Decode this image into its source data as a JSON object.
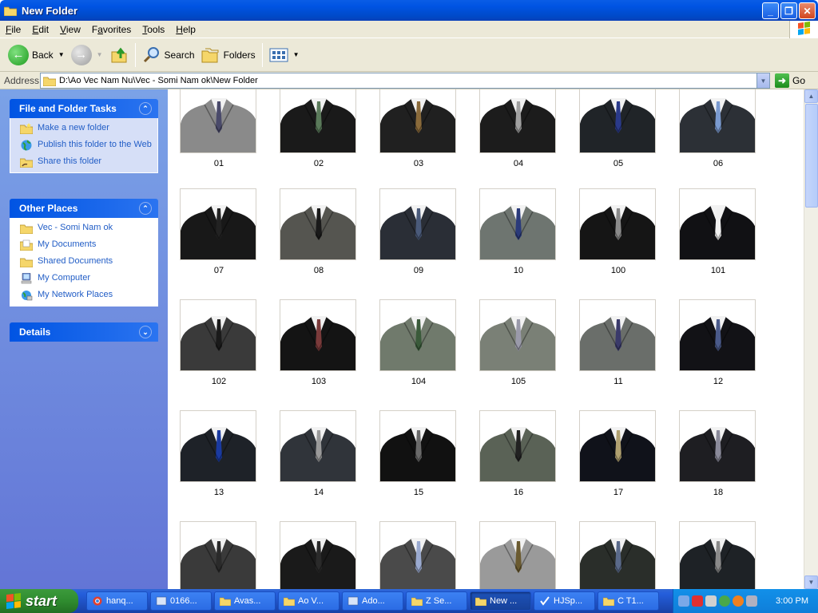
{
  "window": {
    "title": "New Folder"
  },
  "menu": [
    "File",
    "Edit",
    "View",
    "Favorites",
    "Tools",
    "Help"
  ],
  "menu_mnemonics": [
    "F",
    "E",
    "V",
    "a",
    "T",
    "H"
  ],
  "toolbar": {
    "back_label": "Back",
    "search_label": "Search",
    "folders_label": "Folders"
  },
  "address": {
    "label": "Address",
    "value": "D:\\Ao Vec Nam Nu\\Vec - Somi Nam ok\\New Folder",
    "go_label": "Go"
  },
  "sidebar": {
    "tasks": {
      "title": "File and Folder Tasks",
      "items": [
        {
          "label": "Make a new folder"
        },
        {
          "label": "Publish this folder to the Web"
        },
        {
          "label": "Share this folder"
        }
      ]
    },
    "places": {
      "title": "Other Places",
      "items": [
        {
          "label": "Vec - Somi Nam ok"
        },
        {
          "label": "My Documents"
        },
        {
          "label": "Shared Documents"
        },
        {
          "label": "My Computer"
        },
        {
          "label": "My Network Places"
        }
      ]
    },
    "details": {
      "title": "Details"
    }
  },
  "files": [
    {
      "name": "01",
      "suit": "#8a8a8a",
      "tie": "#4a4a6a"
    },
    {
      "name": "02",
      "suit": "#1a1a1a",
      "tie": "#5a7a5a"
    },
    {
      "name": "03",
      "suit": "#202020",
      "tie": "#8a6a3a"
    },
    {
      "name": "04",
      "suit": "#1c1c1c",
      "tie": "#a0a0a0"
    },
    {
      "name": "05",
      "suit": "#202428",
      "tie": "#2a3a8a"
    },
    {
      "name": "06",
      "suit": "#2c3036",
      "tie": "#7a9ad0"
    },
    {
      "name": "07",
      "suit": "#181818",
      "tie": "#222222"
    },
    {
      "name": "08",
      "suit": "#555550",
      "tie": "#1a1a1a"
    },
    {
      "name": "09",
      "suit": "#2a2e36",
      "tie": "#4a5a7a"
    },
    {
      "name": "10",
      "suit": "#6e7570",
      "tie": "#2a3a7a"
    },
    {
      "name": "100",
      "suit": "#151515",
      "tie": "#8a8a8a"
    },
    {
      "name": "101",
      "suit": "#111114",
      "tie": "#f0f0f0"
    },
    {
      "name": "102",
      "suit": "#3a3a3a",
      "tie": "#1a1a1a"
    },
    {
      "name": "103",
      "suit": "#141414",
      "tie": "#7a3a3a"
    },
    {
      "name": "104",
      "suit": "#707a6c",
      "tie": "#3a5a3a"
    },
    {
      "name": "105",
      "suit": "#7a8076",
      "tie": "#9a9aaa"
    },
    {
      "name": "11",
      "suit": "#6a6e6a",
      "tie": "#3a3a6a"
    },
    {
      "name": "12",
      "suit": "#121216",
      "tie": "#4a5a8a"
    },
    {
      "name": "13",
      "suit": "#1e2228",
      "tie": "#1a3aa0"
    },
    {
      "name": "14",
      "suit": "#30343a",
      "tie": "#9a9a9a"
    },
    {
      "name": "15",
      "suit": "#111111",
      "tie": "#6a6a6a"
    },
    {
      "name": "16",
      "suit": "#5a6256",
      "tie": "#222222"
    },
    {
      "name": "17",
      "suit": "#10121a",
      "tie": "#b0a070"
    },
    {
      "name": "18",
      "suit": "#1e1e22",
      "tie": "#8a8a9a"
    },
    {
      "name": "",
      "suit": "#3a3a3a",
      "tie": "#2a2a2a"
    },
    {
      "name": "",
      "suit": "#1a1a1a",
      "tie": "#2a2a2a"
    },
    {
      "name": "",
      "suit": "#4a4a4a",
      "tie": "#9aaad0"
    },
    {
      "name": "",
      "suit": "#9a9a9a",
      "tie": "#6a5a30"
    },
    {
      "name": "",
      "suit": "#2a2e2a",
      "tie": "#5a6a8a"
    },
    {
      "name": "",
      "suit": "#1e2226",
      "tie": "#8a8a8a"
    }
  ],
  "taskbar": {
    "start_label": "start",
    "items": [
      {
        "label": "hanq...",
        "icon": "chrome-icon"
      },
      {
        "label": "0166...",
        "icon": "app-icon"
      },
      {
        "label": "Avas...",
        "icon": "folder-icon"
      },
      {
        "label": "Ao V...",
        "icon": "folder-icon"
      },
      {
        "label": "Ado...",
        "icon": "app-icon"
      },
      {
        "label": "Z Se...",
        "icon": "folder-icon"
      },
      {
        "label": "New ...",
        "icon": "folder-icon",
        "active": true
      },
      {
        "label": "HJSp...",
        "icon": "check-icon"
      },
      {
        "label": "C T1...",
        "icon": "folder-icon"
      }
    ],
    "clock": "3:00 PM"
  }
}
